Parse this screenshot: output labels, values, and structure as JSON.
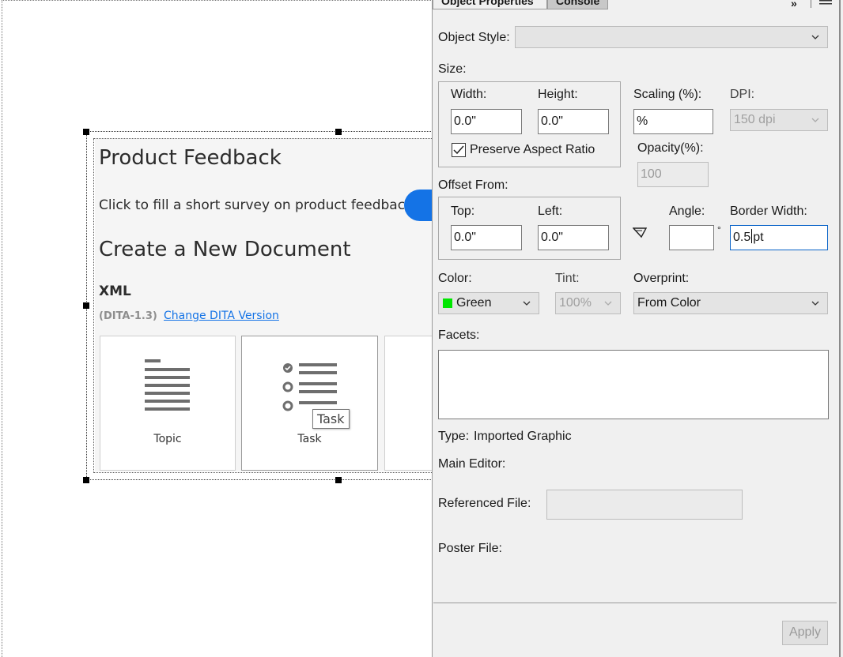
{
  "canvas": {
    "embedded": {
      "title": "Product Feedback",
      "survey_text": "Click to fill a short survey on product feedback",
      "section_title": "Create a New Document",
      "xml_label": "XML",
      "dita_version": "(DITA-1.3)",
      "change_version_link": "Change DITA Version",
      "cards": [
        {
          "label": "Topic",
          "icon": "topic-icon"
        },
        {
          "label": "Task",
          "icon": "task-icon"
        }
      ],
      "tooltip": "Task"
    }
  },
  "panel": {
    "tabs": [
      {
        "label": "Object Properties",
        "active": true
      },
      {
        "label": "Console",
        "active": false
      }
    ],
    "object_style": {
      "label": "Object Style:",
      "value": ""
    },
    "size": {
      "label": "Size:",
      "width_label": "Width:",
      "width_value": "0.0\"",
      "height_label": "Height:",
      "height_value": "0.0\"",
      "preserve_label": "Preserve Aspect Ratio",
      "preserve_checked": true
    },
    "scaling": {
      "label": "Scaling (%):",
      "value": "%"
    },
    "dpi": {
      "label": "DPI:",
      "value": "150 dpi"
    },
    "opacity": {
      "label": "Opacity(%):",
      "value": "100"
    },
    "offset": {
      "label": "Offset From:",
      "top_label": "Top:",
      "top_value": "0.0\"",
      "left_label": "Left:",
      "left_value": "0.0\""
    },
    "angle": {
      "label": "Angle:",
      "value": "",
      "unit": "°"
    },
    "border_width": {
      "label": "Border Width:",
      "value_before_caret": "0.5",
      "value_after_caret": "pt"
    },
    "color": {
      "label": "Color:",
      "value": "Green",
      "swatch": "#00e600"
    },
    "tint": {
      "label": "Tint:",
      "value": "100%"
    },
    "overprint": {
      "label": "Overprint:",
      "value": "From Color"
    },
    "facets": {
      "label": "Facets:",
      "value": ""
    },
    "type": {
      "label": "Type:",
      "value": "Imported Graphic"
    },
    "main_editor": {
      "label": "Main Editor:"
    },
    "referenced_file": {
      "label": "Referenced File:",
      "value": ""
    },
    "poster_file": {
      "label": "Poster File:"
    },
    "apply_label": "Apply"
  }
}
